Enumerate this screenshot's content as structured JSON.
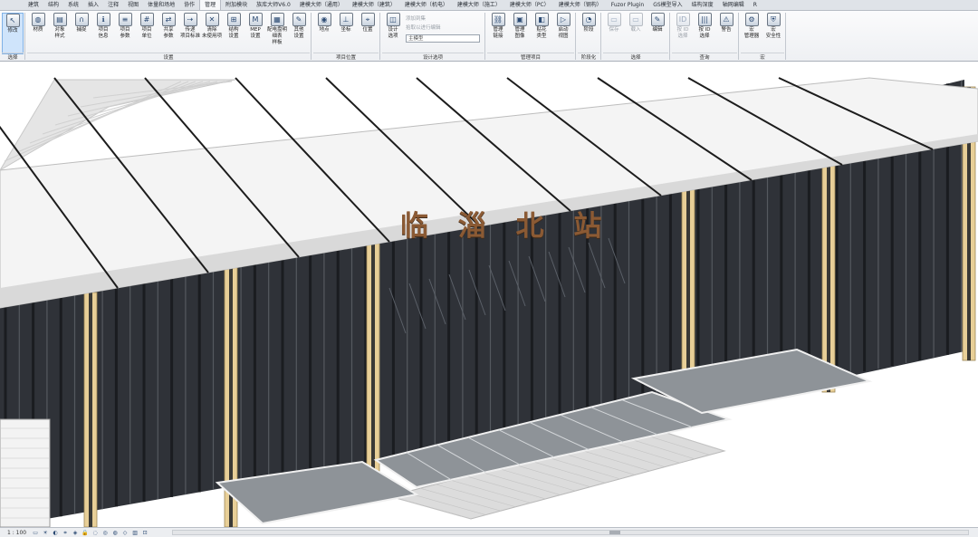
{
  "tabs": [
    "建筑",
    "结构",
    "系统",
    "插入",
    "注释",
    "视图",
    "体量和场地",
    "协作",
    "管理",
    "附加模块",
    "族库大师V6.0",
    "建模大师（通用）",
    "建模大师（建筑）",
    "建模大师（机电）",
    "建模大师（施工）",
    "建模大师（PC）",
    "建模大师（钢构）",
    "Fuzor Plugin",
    "GS模型导入",
    "结构深度",
    "轴网编辑",
    "R"
  ],
  "active_tab": "管理",
  "ribbon": {
    "groups": [
      {
        "label": "选择",
        "buttons": [
          {
            "label": "修改",
            "icon": "arrow-cursor-icon",
            "selected": true
          }
        ]
      },
      {
        "label": "设置",
        "buttons": [
          {
            "label": "材质",
            "icon": "material-sphere-icon"
          },
          {
            "label": "对象\n样式",
            "icon": "object-styles-icon"
          },
          {
            "label": "捕捉",
            "icon": "magnet-icon"
          },
          {
            "label": "项目\n信息",
            "icon": "project-info-icon"
          },
          {
            "label": "项目\n参数",
            "icon": "project-parameters-icon"
          },
          {
            "label": "项目\n单位",
            "icon": "project-units-icon"
          },
          {
            "label": "共享\n参数",
            "icon": "shared-parameters-icon"
          },
          {
            "label": "传递\n项目标准",
            "icon": "transfer-standards-icon"
          },
          {
            "label": "清除\n未使用项",
            "icon": "purge-unused-icon"
          },
          {
            "label": "结构\n设置",
            "icon": "structural-settings-icon"
          },
          {
            "label": "MEP\n设置",
            "icon": "mep-settings-icon"
          },
          {
            "label": "配电盘明细表\n样板",
            "icon": "panel-schedule-icon"
          },
          {
            "label": "其他\n设置",
            "icon": "wrench-icon"
          }
        ]
      },
      {
        "label": "项目位置",
        "buttons": [
          {
            "label": "地点",
            "icon": "globe-icon"
          },
          {
            "label": "坐标",
            "icon": "coordinates-icon"
          },
          {
            "label": "位置",
            "icon": "position-icon"
          }
        ]
      },
      {
        "label": "设计选项",
        "buttons": [
          {
            "label": "设计\n选项",
            "icon": "design-options-icon"
          }
        ],
        "small": [
          "添加到集",
          "拾取以进行编辑"
        ],
        "combo": "主模型"
      },
      {
        "label": "管理项目",
        "buttons": [
          {
            "label": "管理\n链接",
            "icon": "manage-links-icon"
          },
          {
            "label": "管理\n图像",
            "icon": "manage-images-icon"
          },
          {
            "label": "贴花\n类型",
            "icon": "decal-types-icon"
          },
          {
            "label": "启动\n视图",
            "icon": "starting-view-icon"
          }
        ]
      },
      {
        "label": "阶段化",
        "buttons": [
          {
            "label": "阶段",
            "icon": "phases-icon"
          }
        ]
      },
      {
        "label": "选择",
        "buttons": [
          {
            "label": "保存",
            "icon": "save-selection-icon",
            "dim": true
          },
          {
            "label": "载入",
            "icon": "load-selection-icon",
            "dim": true
          },
          {
            "label": "编辑",
            "icon": "edit-selection-icon"
          }
        ]
      },
      {
        "label": "查询",
        "buttons": [
          {
            "label": "按 ID\n选择",
            "icon": "select-by-id-icon",
            "dim": true
          },
          {
            "label": "按 ID\n选择",
            "icon": "barcode-icon"
          },
          {
            "label": "警告",
            "icon": "warning-icon"
          }
        ]
      },
      {
        "label": "宏",
        "buttons": [
          {
            "label": "宏\n管理器",
            "icon": "macro-manager-icon"
          },
          {
            "label": "宏\n安全性",
            "icon": "macro-security-icon"
          }
        ]
      }
    ]
  },
  "viewport": {
    "sign_text": "临 淄 北 站",
    "colors": {
      "glass": "#2f3238",
      "mullion": "#1a1c20",
      "roof": "#f4f4f4",
      "column_gold": "#e8cf97",
      "canopy": "#8e9398",
      "paving": "#dcdcdc"
    }
  },
  "statusbar": {
    "scale": "1 : 100",
    "icons": [
      "page-icon",
      "sun-icon",
      "shadow-icon",
      "crop-icon",
      "render-icon",
      "lock-icon",
      "hide-icon",
      "temporary-hide-icon",
      "reveal-icon",
      "highlight-icon",
      "analysis-icon",
      "constraints-icon"
    ]
  }
}
